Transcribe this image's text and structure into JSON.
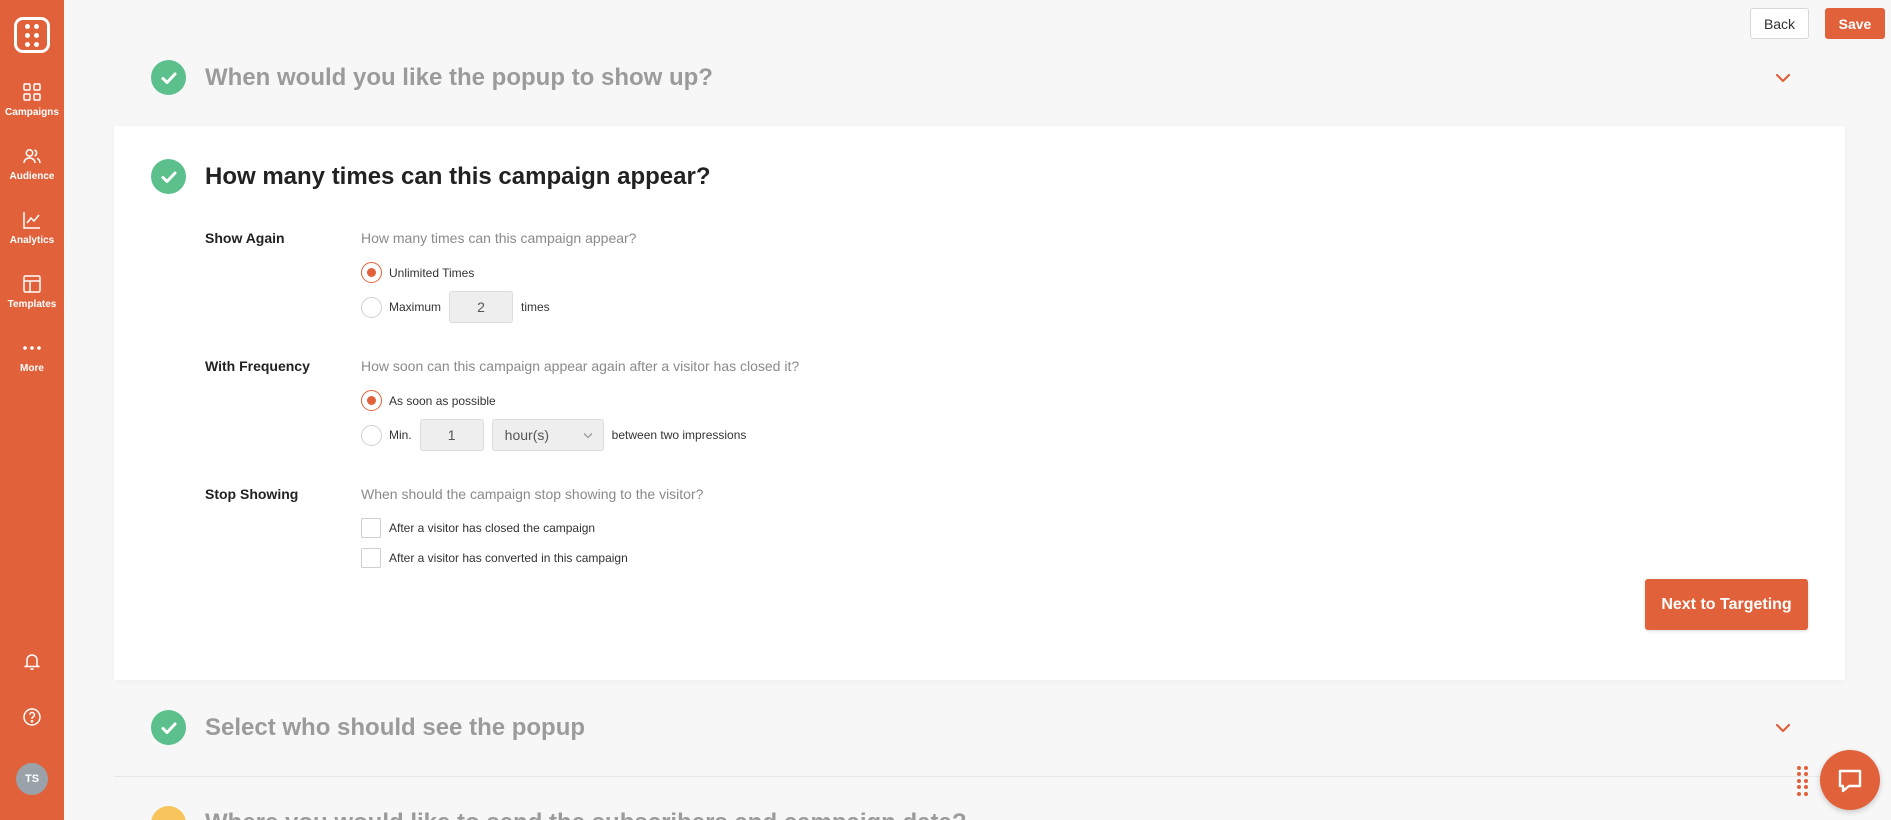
{
  "sidebar": {
    "items": [
      {
        "label": "Campaigns",
        "icon": "grid-icon"
      },
      {
        "label": "Audience",
        "icon": "users-icon"
      },
      {
        "label": "Analytics",
        "icon": "chart-icon"
      },
      {
        "label": "Templates",
        "icon": "layout-icon"
      },
      {
        "label": "More",
        "icon": "more-icon"
      }
    ],
    "avatar": "TS"
  },
  "toolbar": {
    "back_label": "Back",
    "save_label": "Save"
  },
  "steps": {
    "step1": {
      "title": "When would you like the popup to show up?"
    },
    "step2": {
      "title": "How many times can this campaign appear?",
      "show_again": {
        "label": "Show Again",
        "question": "How many times can this campaign appear?",
        "unlimited_label": "Unlimited Times",
        "maximum_label": "Maximum",
        "maximum_value": "2",
        "times_label": "times",
        "selected": "unlimited"
      },
      "frequency": {
        "label": "With Frequency",
        "question": "How soon can this campaign appear again after a visitor has closed it?",
        "asap_label": "As soon as possible",
        "min_label": "Min.",
        "min_value": "1",
        "unit_selected": "hour(s)",
        "between_label": "between two impressions",
        "selected": "asap"
      },
      "stop_showing": {
        "label": "Stop Showing",
        "question": "When should the campaign stop showing to the visitor?",
        "closed_label": "After a visitor has closed the campaign",
        "converted_label": "After a visitor has converted in this campaign"
      },
      "next_label": "Next to Targeting"
    },
    "step3": {
      "title": "Select who should see the popup"
    },
    "step4": {
      "title": "Where you would like to send the subscribers and campaign data?"
    }
  },
  "colors": {
    "brand": "#e0613a",
    "success": "#5cc08c",
    "pending": "#f6c45a"
  }
}
